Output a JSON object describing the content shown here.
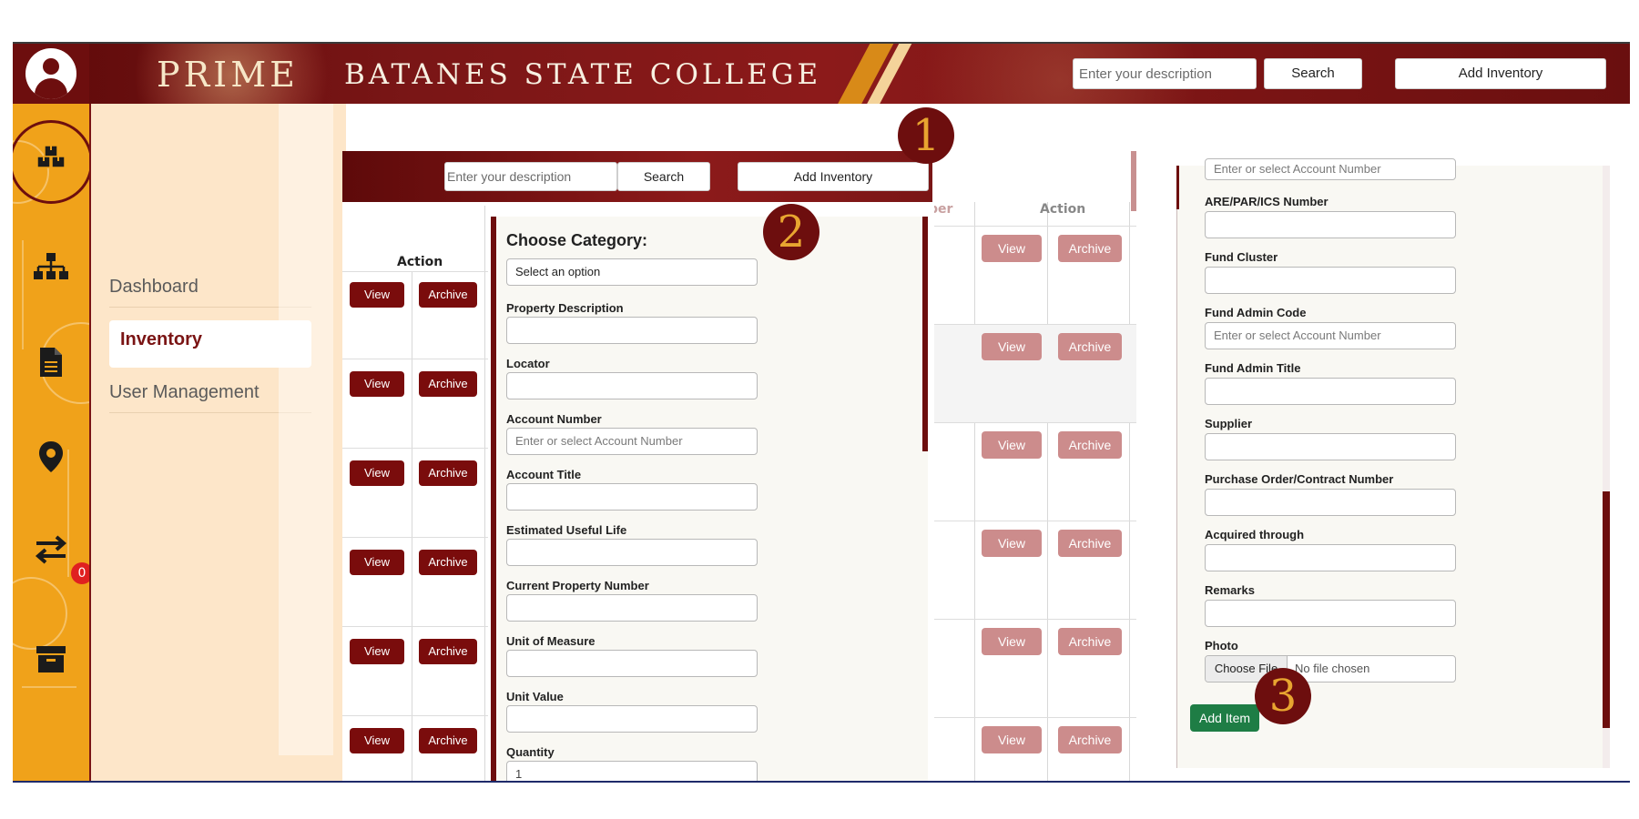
{
  "header": {
    "brand": "PRIME",
    "college": "BATANES STATE COLLEGE",
    "search_placeholder": "Enter your description",
    "search_label": "Search",
    "add_inventory_label": "Add Inventory"
  },
  "notifications": {
    "transfer_count": "0"
  },
  "nav": {
    "items": [
      {
        "label": "Dashboard"
      },
      {
        "label": "Inventory"
      },
      {
        "label": "User Management"
      }
    ]
  },
  "panel1": {
    "search_placeholder": "Enter your description",
    "search_label": "Search",
    "add_inventory_label": "Add Inventory",
    "action_header": "Action",
    "view_label": "View",
    "archive_label": "Archive",
    "form": {
      "choose_category": "Choose Category:",
      "select_option": "Select an option",
      "property_description": "Property Description",
      "locator": "Locator",
      "account_number": "Account Number",
      "account_number_placeholder": "Enter or select Account Number",
      "account_title": "Account Title",
      "estimated_useful_life": "Estimated Useful Life",
      "current_property_number": "Current Property Number",
      "unit_of_measure": "Unit of Measure",
      "unit_value": "Unit Value",
      "quantity": "Quantity",
      "quantity_value": "1"
    }
  },
  "panel2": {
    "partial_header": "ber",
    "action_header": "Action",
    "view_label": "View",
    "archive_label": "Archive"
  },
  "panel3": {
    "account_number_placeholder": "Enter or select Account Number",
    "are_par_ics": "ARE/PAR/ICS Number",
    "fund_cluster": "Fund Cluster",
    "fund_admin_code": "Fund Admin Code",
    "fund_admin_code_placeholder": "Enter or select Account Number",
    "fund_admin_title": "Fund Admin Title",
    "supplier": "Supplier",
    "purchase_order": "Purchase Order/Contract Number",
    "acquired_through": "Acquired through",
    "remarks": "Remarks",
    "photo": "Photo",
    "choose_file": "Choose File",
    "no_file": "No file chosen",
    "add_item": "Add Item"
  },
  "steps": [
    "1",
    "2",
    "3"
  ],
  "colors": {
    "maroon": "#6d0e0e",
    "gold": "#f0a21a",
    "cream": "#fde6c9",
    "green": "#1e7d45"
  }
}
